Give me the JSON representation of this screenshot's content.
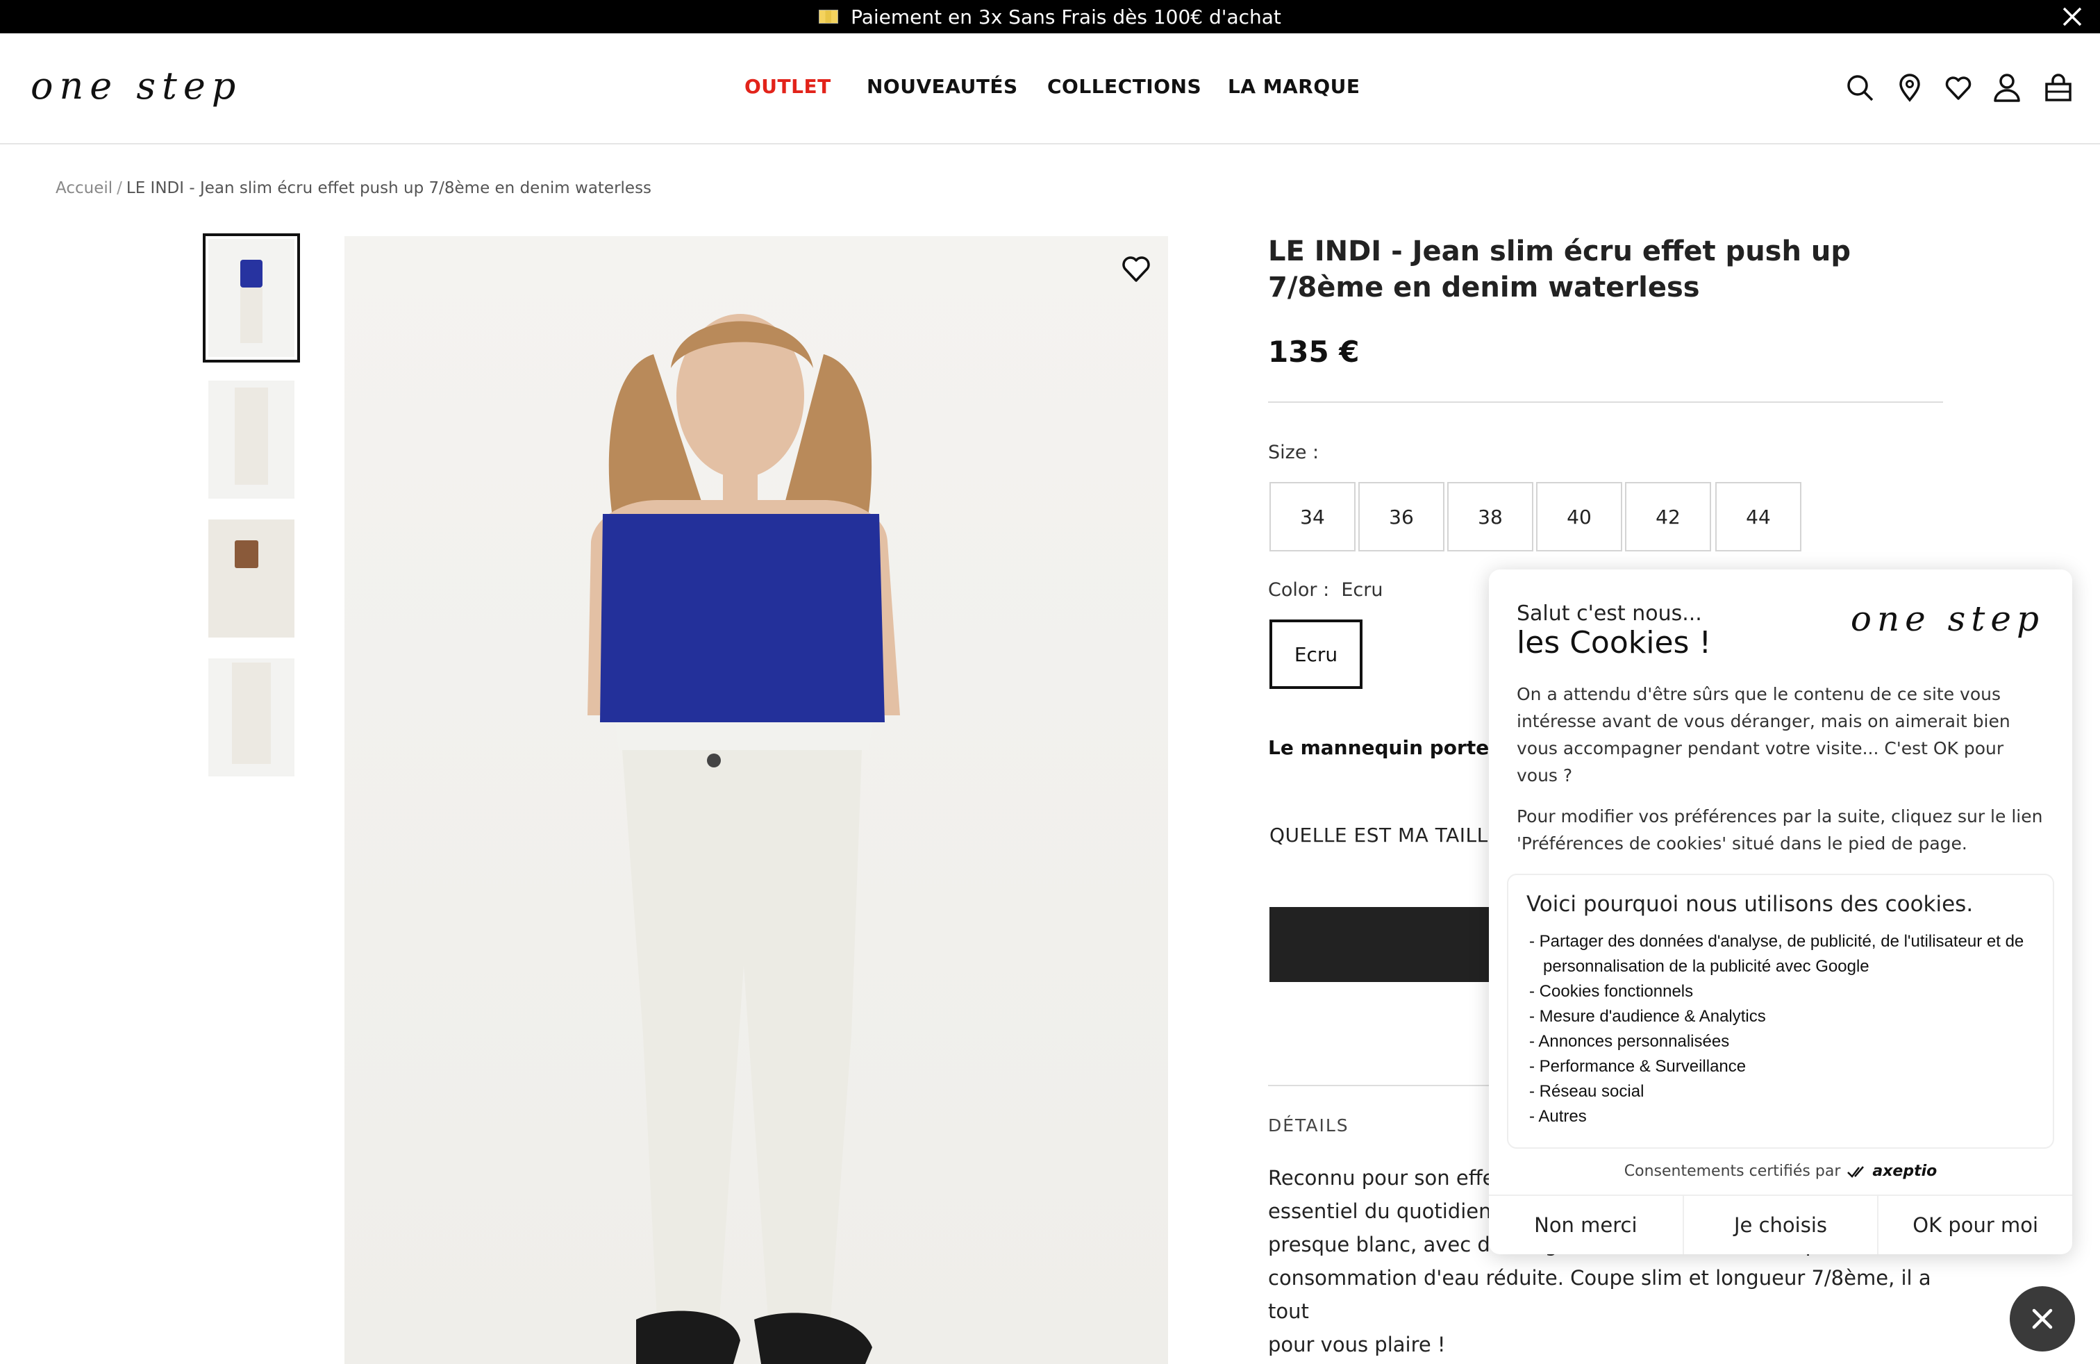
{
  "promo": {
    "text": "Paiement en 3x Sans Frais dès 100€ d'achat"
  },
  "header": {
    "logo": "one step",
    "nav": [
      "OUTLET",
      "NOUVEAUTÉS",
      "COLLECTIONS",
      "LA MARQUE"
    ],
    "icons": [
      "search-icon",
      "location-icon",
      "heart-icon",
      "user-icon",
      "bag-icon"
    ]
  },
  "breadcrumb": {
    "home": "Accueil",
    "sep": "/",
    "current": "LE INDI - Jean slim écru effet push up 7/8ème en denim waterless"
  },
  "product": {
    "title": "LE INDI - Jean slim écru effet push up 7/8ème en denim waterless",
    "price": "135 €",
    "size_label": "Size :",
    "sizes": [
      "34",
      "36",
      "38",
      "40",
      "42",
      "44"
    ],
    "color_label": "Color :",
    "color_value": "Ecru",
    "color_option": "Ecru",
    "model_text": "Le mannequin porte une",
    "size_guide": "QUELLE EST MA TAILLE",
    "details_label": "DÉTAILS",
    "description_lines": [
      "Reconnu pour son effet",
      "essentiel du quotidien. C",
      "presque blanc, avec délavage waterless, celui-ci des process à",
      "consommation d'eau réduite. Coupe slim et longueur 7/8ème, il a tout",
      "pour vous plaire !"
    ]
  },
  "cookie": {
    "greeting": "Salut c'est nous...",
    "title": "les Cookies !",
    "logo": "one step",
    "para1": "On a attendu d'être sûrs que le contenu de ce site vous intéresse avant de vous déranger, mais on aimerait bien vous accompagner pendant votre visite... C'est OK pour vous ?",
    "para2": "Pour modifier vos préférences par la suite, cliquez sur le lien 'Préférences de cookies' situé dans le pied de page.",
    "why_title": "Voici pourquoi nous utilisons des cookies.",
    "why_list": [
      "- Partager des données d'analyse, de publicité, de l'utilisateur et de personnalisation de la publicité avec Google",
      "- Cookies fonctionnels",
      "- Mesure d'audience & Analytics",
      "- Annonces personnalisées",
      "- Performance & Surveillance",
      "- Réseau social",
      "- Autres"
    ],
    "certified": "Consentements certifiés par",
    "certified_brand": "axeptio",
    "buttons": [
      "Non merci",
      "Je choisis",
      "OK pour moi"
    ]
  },
  "colors": {
    "accent_outlet": "#e2231a",
    "top_bar": "#000000",
    "primary_button": "#222222"
  }
}
